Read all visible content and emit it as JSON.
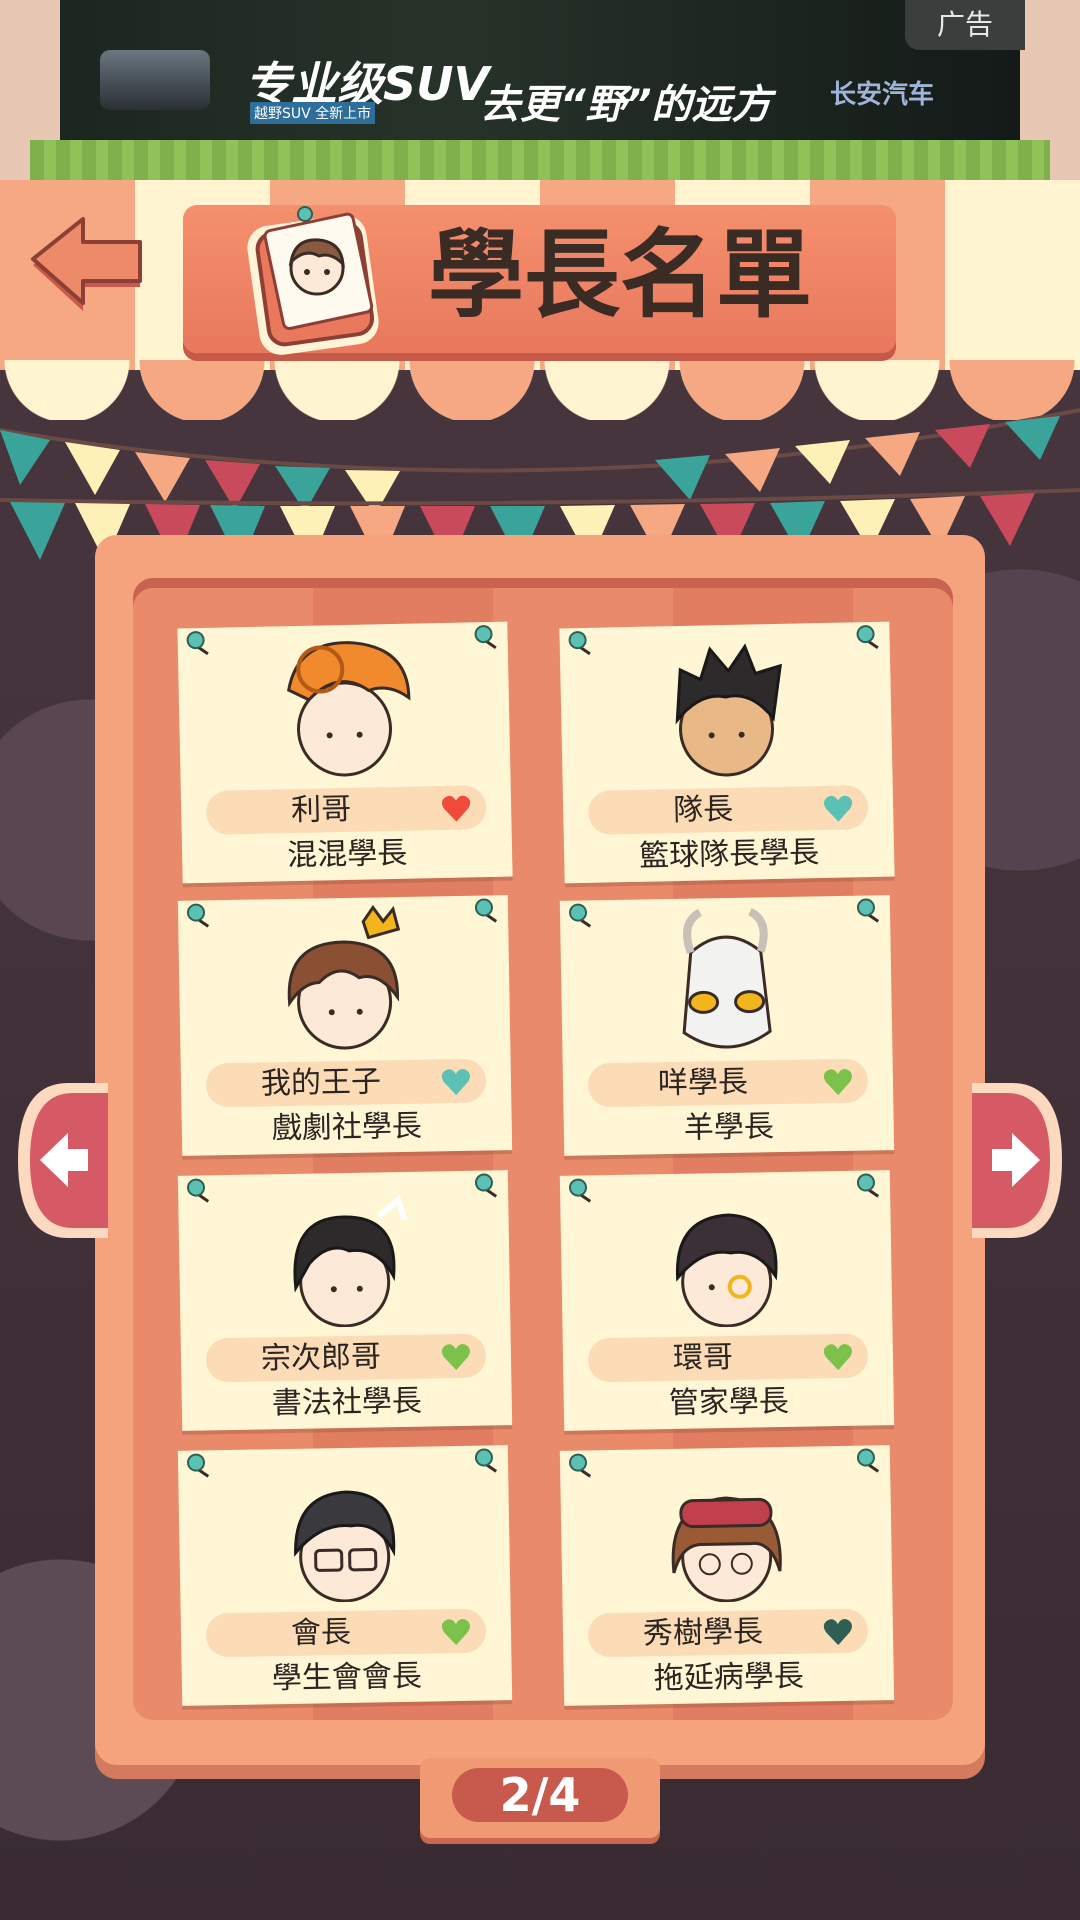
{
  "ad": {
    "tag": "广告",
    "headline": "专业级SUV",
    "slogan": "去更“野”的远方",
    "subline": "越野SUV 全新上市",
    "brand": "长安汽车"
  },
  "header": {
    "title": "學長名單"
  },
  "cards": [
    {
      "nick": "利哥",
      "role": "混混學長",
      "heart_color": "#f04a3a",
      "icon": "pompadour-orange-hair"
    },
    {
      "nick": "隊長",
      "role": "籃球隊長學長",
      "heart_color": "#5cc1b5",
      "icon": "spiky-black-hair"
    },
    {
      "nick": "我的王子",
      "role": "戲劇社學長",
      "heart_color": "#5cc1b5",
      "icon": "crown-brown-hair"
    },
    {
      "nick": "咩學長",
      "role": "羊學長",
      "heart_color": "#7cc24a",
      "icon": "goat-head"
    },
    {
      "nick": "宗次郎哥",
      "role": "書法社學長",
      "heart_color": "#7cc24a",
      "icon": "topknot-black-hair"
    },
    {
      "nick": "環哥",
      "role": "管家學長",
      "heart_color": "#7cc24a",
      "icon": "monocle-dark-hair"
    },
    {
      "nick": "會長",
      "role": "學生會會長",
      "heart_color": "#7cc24a",
      "icon": "glasses-dark-hair"
    },
    {
      "nick": "秀樹學長",
      "role": "拖延病學長",
      "heart_color": "#2f5e52",
      "icon": "sleep-mask-brown-hair"
    }
  ],
  "pagination": {
    "label": "2/4"
  },
  "colors": {
    "title_board": "#ef8566",
    "card_bg": "#fff6d6",
    "page_pill": "#c85a4d"
  }
}
